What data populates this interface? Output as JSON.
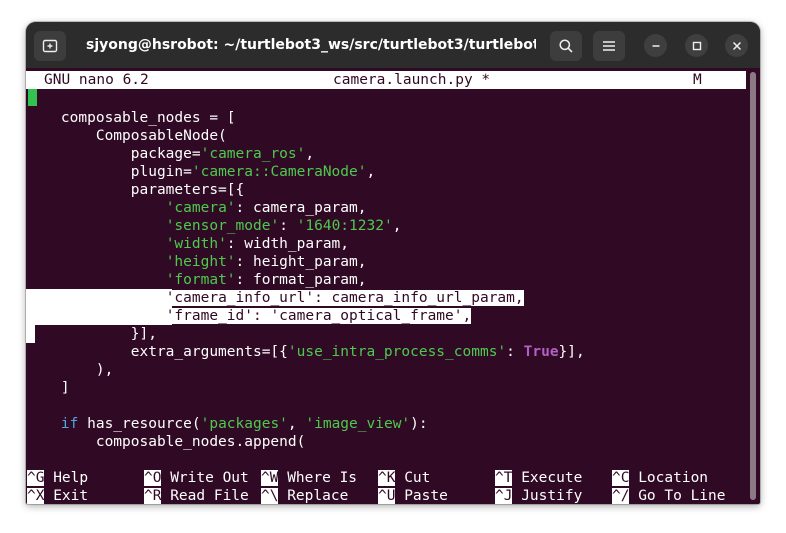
{
  "window": {
    "title": "sjyong@hsrobot: ~/turtlebot3_ws/src/turtlebot3/turtlebot3...",
    "icons": {
      "new_tab": "new-tab-icon",
      "search": "search-icon",
      "menu": "hamburger-menu-icon",
      "minimize": "minimize-icon",
      "maximize": "maximize-icon",
      "close": "close-icon"
    }
  },
  "nano": {
    "version": "GNU nano 6.2",
    "filename": "camera.launch.py *",
    "modified": "M"
  },
  "code": {
    "l1": "    composable_nodes = [",
    "l2": "        ComposableNode(",
    "l3_a": "            package=",
    "l3_b": "'camera_ros'",
    "l3_c": ",",
    "l4_a": "            plugin=",
    "l4_b": "'camera::CameraNode'",
    "l4_c": ",",
    "l5": "            parameters=[{",
    "l6_a": "                ",
    "l6_b": "'camera'",
    "l6_c": ": camera_param,",
    "l7_a": "                ",
    "l7_b": "'sensor_mode'",
    "l7_c": ": ",
    "l7_d": "'1640:1232'",
    "l7_e": ",",
    "l8_a": "                ",
    "l8_b": "'width'",
    "l8_c": ": width_param,",
    "l9_a": "                ",
    "l9_b": "'height'",
    "l9_c": ": height_param,",
    "l10_a": "                ",
    "l10_b": "'format'",
    "l10_c": ": format_param,",
    "l11_a": "                ",
    "l11_b": "'camera_info_url': camera_info_url_param,",
    "l12_a": "                ",
    "l12_b": "'frame_id': 'camera_optical_frame',",
    "l13": "            }],",
    "l14_a": "            extra_arguments=[{",
    "l14_b": "'use_intra_process_comms'",
    "l14_c": ": ",
    "l14_d": "True",
    "l14_e": "}],",
    "l15": "        ),",
    "l16": "    ]",
    "l17": "",
    "l18_a": "    ",
    "l18_b": "if",
    "l18_c": " has_resource(",
    "l18_d": "'packages'",
    "l18_e": ", ",
    "l18_f": "'image_view'",
    "l18_g": "):",
    "l19": "        composable_nodes.append("
  },
  "shortcuts": [
    {
      "key": "^G",
      "label": "Help"
    },
    {
      "key": "^O",
      "label": "Write Out"
    },
    {
      "key": "^W",
      "label": "Where Is"
    },
    {
      "key": "^K",
      "label": "Cut"
    },
    {
      "key": "^T",
      "label": "Execute"
    },
    {
      "key": "^C",
      "label": "Location"
    },
    {
      "key": "^X",
      "label": "Exit"
    },
    {
      "key": "^R",
      "label": "Read File"
    },
    {
      "key": "^\\",
      "label": "Replace"
    },
    {
      "key": "^U",
      "label": "Paste"
    },
    {
      "key": "^J",
      "label": "Justify"
    },
    {
      "key": "^/",
      "label": "Go To Line"
    }
  ],
  "colors": {
    "terminal_bg": "#300a24",
    "string": "#4ec94e",
    "keyword": "#4fa6e0",
    "boolean": "#b35fc6",
    "cursor": "#33c24f"
  }
}
